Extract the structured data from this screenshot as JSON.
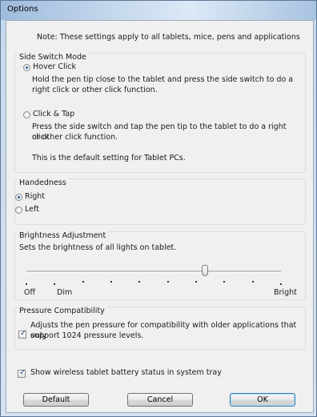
{
  "window": {
    "title": "Options"
  },
  "note": "Note: These settings apply to all tablets, mice, pens and applications",
  "side_switch": {
    "title": "Side Switch Mode",
    "options": [
      {
        "label": "Hover Click",
        "selected": true,
        "description": [
          "Hold the pen tip close to the tablet and press the side switch to do a",
          "right click or other click function."
        ]
      },
      {
        "label": "Click & Tap",
        "selected": false,
        "description": [
          "Press the side switch and tap the pen tip to the tablet to do a right click",
          "or other click function."
        ],
        "extra": "This is the default setting for Tablet PCs."
      }
    ]
  },
  "handedness": {
    "title": "Handedness",
    "options": [
      {
        "label": "Right",
        "selected": true
      },
      {
        "label": "Left",
        "selected": false
      }
    ]
  },
  "brightness": {
    "title": "Brightness Adjustment",
    "description": "Sets the brightness of all lights on tablet.",
    "labels": {
      "off": "Off",
      "dim": "Dim",
      "bright": "Bright"
    },
    "tick_count": 10,
    "level_fraction": 0.7
  },
  "pressure": {
    "title": "Pressure Compatibility",
    "checked": true,
    "label": [
      "Adjusts the pen pressure for compatibility with older applications that only",
      "support 1024 pressure levels."
    ]
  },
  "battery": {
    "checked": true,
    "label": "Show wireless tablet battery status in system tray"
  },
  "buttons": {
    "default": "Default",
    "cancel": "Cancel",
    "ok": "OK"
  },
  "colors": {
    "accent": "#3c7fb1",
    "dialog_bg": "#f0f0f0",
    "titlebar": "#c4d7ec"
  }
}
